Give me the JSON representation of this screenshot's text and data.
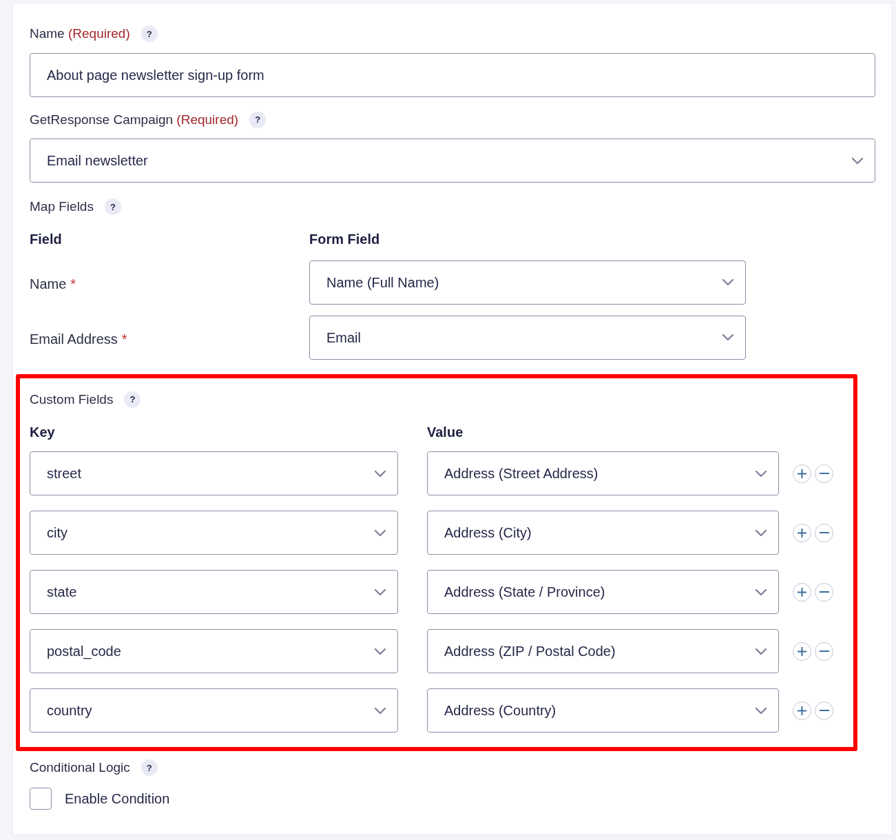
{
  "name_field": {
    "label": "Name",
    "required_note": "(Required)",
    "help": "?",
    "value": "About page newsletter sign-up form"
  },
  "campaign_field": {
    "label": "GetResponse Campaign",
    "required_note": "(Required)",
    "help": "?",
    "value": "Email newsletter"
  },
  "map_fields": {
    "label": "Map Fields",
    "help": "?",
    "columns": [
      "Field",
      "Form Field"
    ],
    "rows": [
      {
        "field": "Name",
        "required": true,
        "asterisk": "*",
        "value": "Name (Full Name)"
      },
      {
        "field": "Email Address",
        "required": true,
        "asterisk": "*",
        "value": "Email"
      }
    ]
  },
  "custom_fields": {
    "highlighted": true,
    "label": "Custom Fields",
    "help": "?",
    "columns": [
      "Key",
      "Value"
    ],
    "rows": [
      {
        "key": "street",
        "value": "Address (Street Address)"
      },
      {
        "key": "city",
        "value": "Address (City)"
      },
      {
        "key": "state",
        "value": "Address (State / Province)"
      },
      {
        "key": "postal_code",
        "value": "Address (ZIP / Postal Code)"
      },
      {
        "key": "country",
        "value": "Address (Country)"
      }
    ]
  },
  "conditional_logic": {
    "label": "Conditional Logic",
    "help": "?",
    "checkbox": {
      "label": "Enable Condition",
      "checked": false
    }
  }
}
